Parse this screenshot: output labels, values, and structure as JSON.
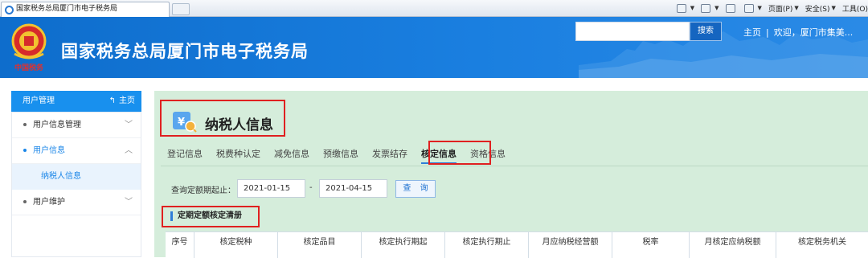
{
  "browser": {
    "tab_title": "国家税务总局厦门市电子税务局",
    "commands": [
      "页面(P)",
      "安全(S)",
      "工具(O)"
    ]
  },
  "header": {
    "emblem_caption": "中国税务",
    "site_title": "国家税务总局厦门市电子税务局",
    "search_placeholder": "",
    "search_button": "搜索",
    "home_link": "主页",
    "separator": "|",
    "welcome": "欢迎，厦门市集美..."
  },
  "sidebar": {
    "title": "用户管理",
    "home": "主页",
    "items": [
      {
        "label": "用户信息管理",
        "chevron": "chevron-down"
      },
      {
        "label": "用户信息",
        "chevron": "chevron-up",
        "active": true
      },
      {
        "label": "用户维护",
        "chevron": "chevron-down"
      }
    ],
    "sub_item": "纳税人信息"
  },
  "main": {
    "page_title": "纳税人信息",
    "tabs": [
      {
        "label": "登记信息"
      },
      {
        "label": "税费种认定"
      },
      {
        "label": "减免信息"
      },
      {
        "label": "预缴信息"
      },
      {
        "label": "发票结存"
      },
      {
        "label": "核定信息",
        "selected": true
      },
      {
        "label": "资格信息"
      }
    ],
    "query": {
      "label": "查询定额期起止：",
      "start_date": "2021-01-15",
      "separator": "-",
      "end_date": "2021-04-15",
      "button": "查 询"
    },
    "section_title": "定期定额核定清册",
    "table": {
      "columns": [
        "序号",
        "核定税种",
        "核定品目",
        "核定执行期起",
        "核定执行期止",
        "月应纳税经营额",
        "税率",
        "月核定应纳税额",
        "核定税务机关"
      ]
    }
  },
  "colors": {
    "header_blue": "#1a7fe0",
    "sidebar_blue": "#1890ee",
    "content_green": "#d5eddb",
    "highlight_red": "#e02020",
    "accent_blue": "#2f7ed8"
  }
}
